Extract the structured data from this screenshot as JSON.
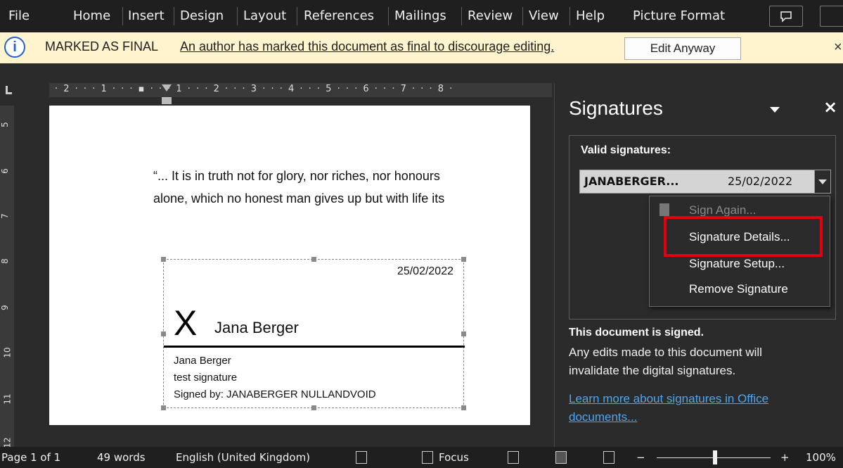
{
  "ribbon": {
    "tabs": [
      "File",
      "Home",
      "Insert",
      "Design",
      "Layout",
      "References",
      "Mailings",
      "Review",
      "View",
      "Help",
      "Picture Format"
    ],
    "comments_icon": "comment-icon"
  },
  "infobar": {
    "title": "MARKED AS FINAL",
    "message": "An author has marked this document as final to discourage editing.",
    "button": "Edit Anyway",
    "close": "×"
  },
  "ruler": {
    "horizontal": "· 2 · · · 1 · · · ▪ · · · 1 · · · 2 · · · 3 · · · 4 · · · 5 · · · 6 · · · 7 · · · 8 ·",
    "vertical": [
      "5",
      "6",
      "7",
      "8",
      "9",
      "10",
      "11",
      "12"
    ]
  },
  "document": {
    "quote_line1": "“... It is in truth not for glory, nor riches, nor honours",
    "quote_line2": "alone, which no honest man gives up but with life its",
    "signature": {
      "date": "25/02/2022",
      "mark": "X",
      "name": "Jana Berger",
      "signer_name": "Jana Berger",
      "signer_title": "test signature",
      "signed_by": "Signed by: JANABERGER NULLANDVOID"
    }
  },
  "pane": {
    "title": "Signatures",
    "close": "×",
    "valid_label": "Valid signatures:",
    "entry": {
      "name": "JANABERGER...",
      "date": "25/02/2022"
    },
    "menu": {
      "sign_again": "Sign Again...",
      "details": "Signature Details...",
      "setup": "Signature Setup...",
      "remove": "Remove Signature"
    },
    "signed_title": "This document is signed.",
    "signed_message": "Any edits made to this document will invalidate the digital signatures.",
    "learn_more": "Learn more about signatures in Office documents..."
  },
  "status": {
    "page": "Page 1 of 1",
    "words": "49 words",
    "language": "English (United Kingdom)",
    "focus": "Focus",
    "zoom_minus": "−",
    "zoom_plus": "+",
    "zoom": "100%"
  },
  "colors": {
    "infobar_bg": "#fff4ce",
    "highlight": "#e3000f",
    "link": "#4ea6f2"
  }
}
